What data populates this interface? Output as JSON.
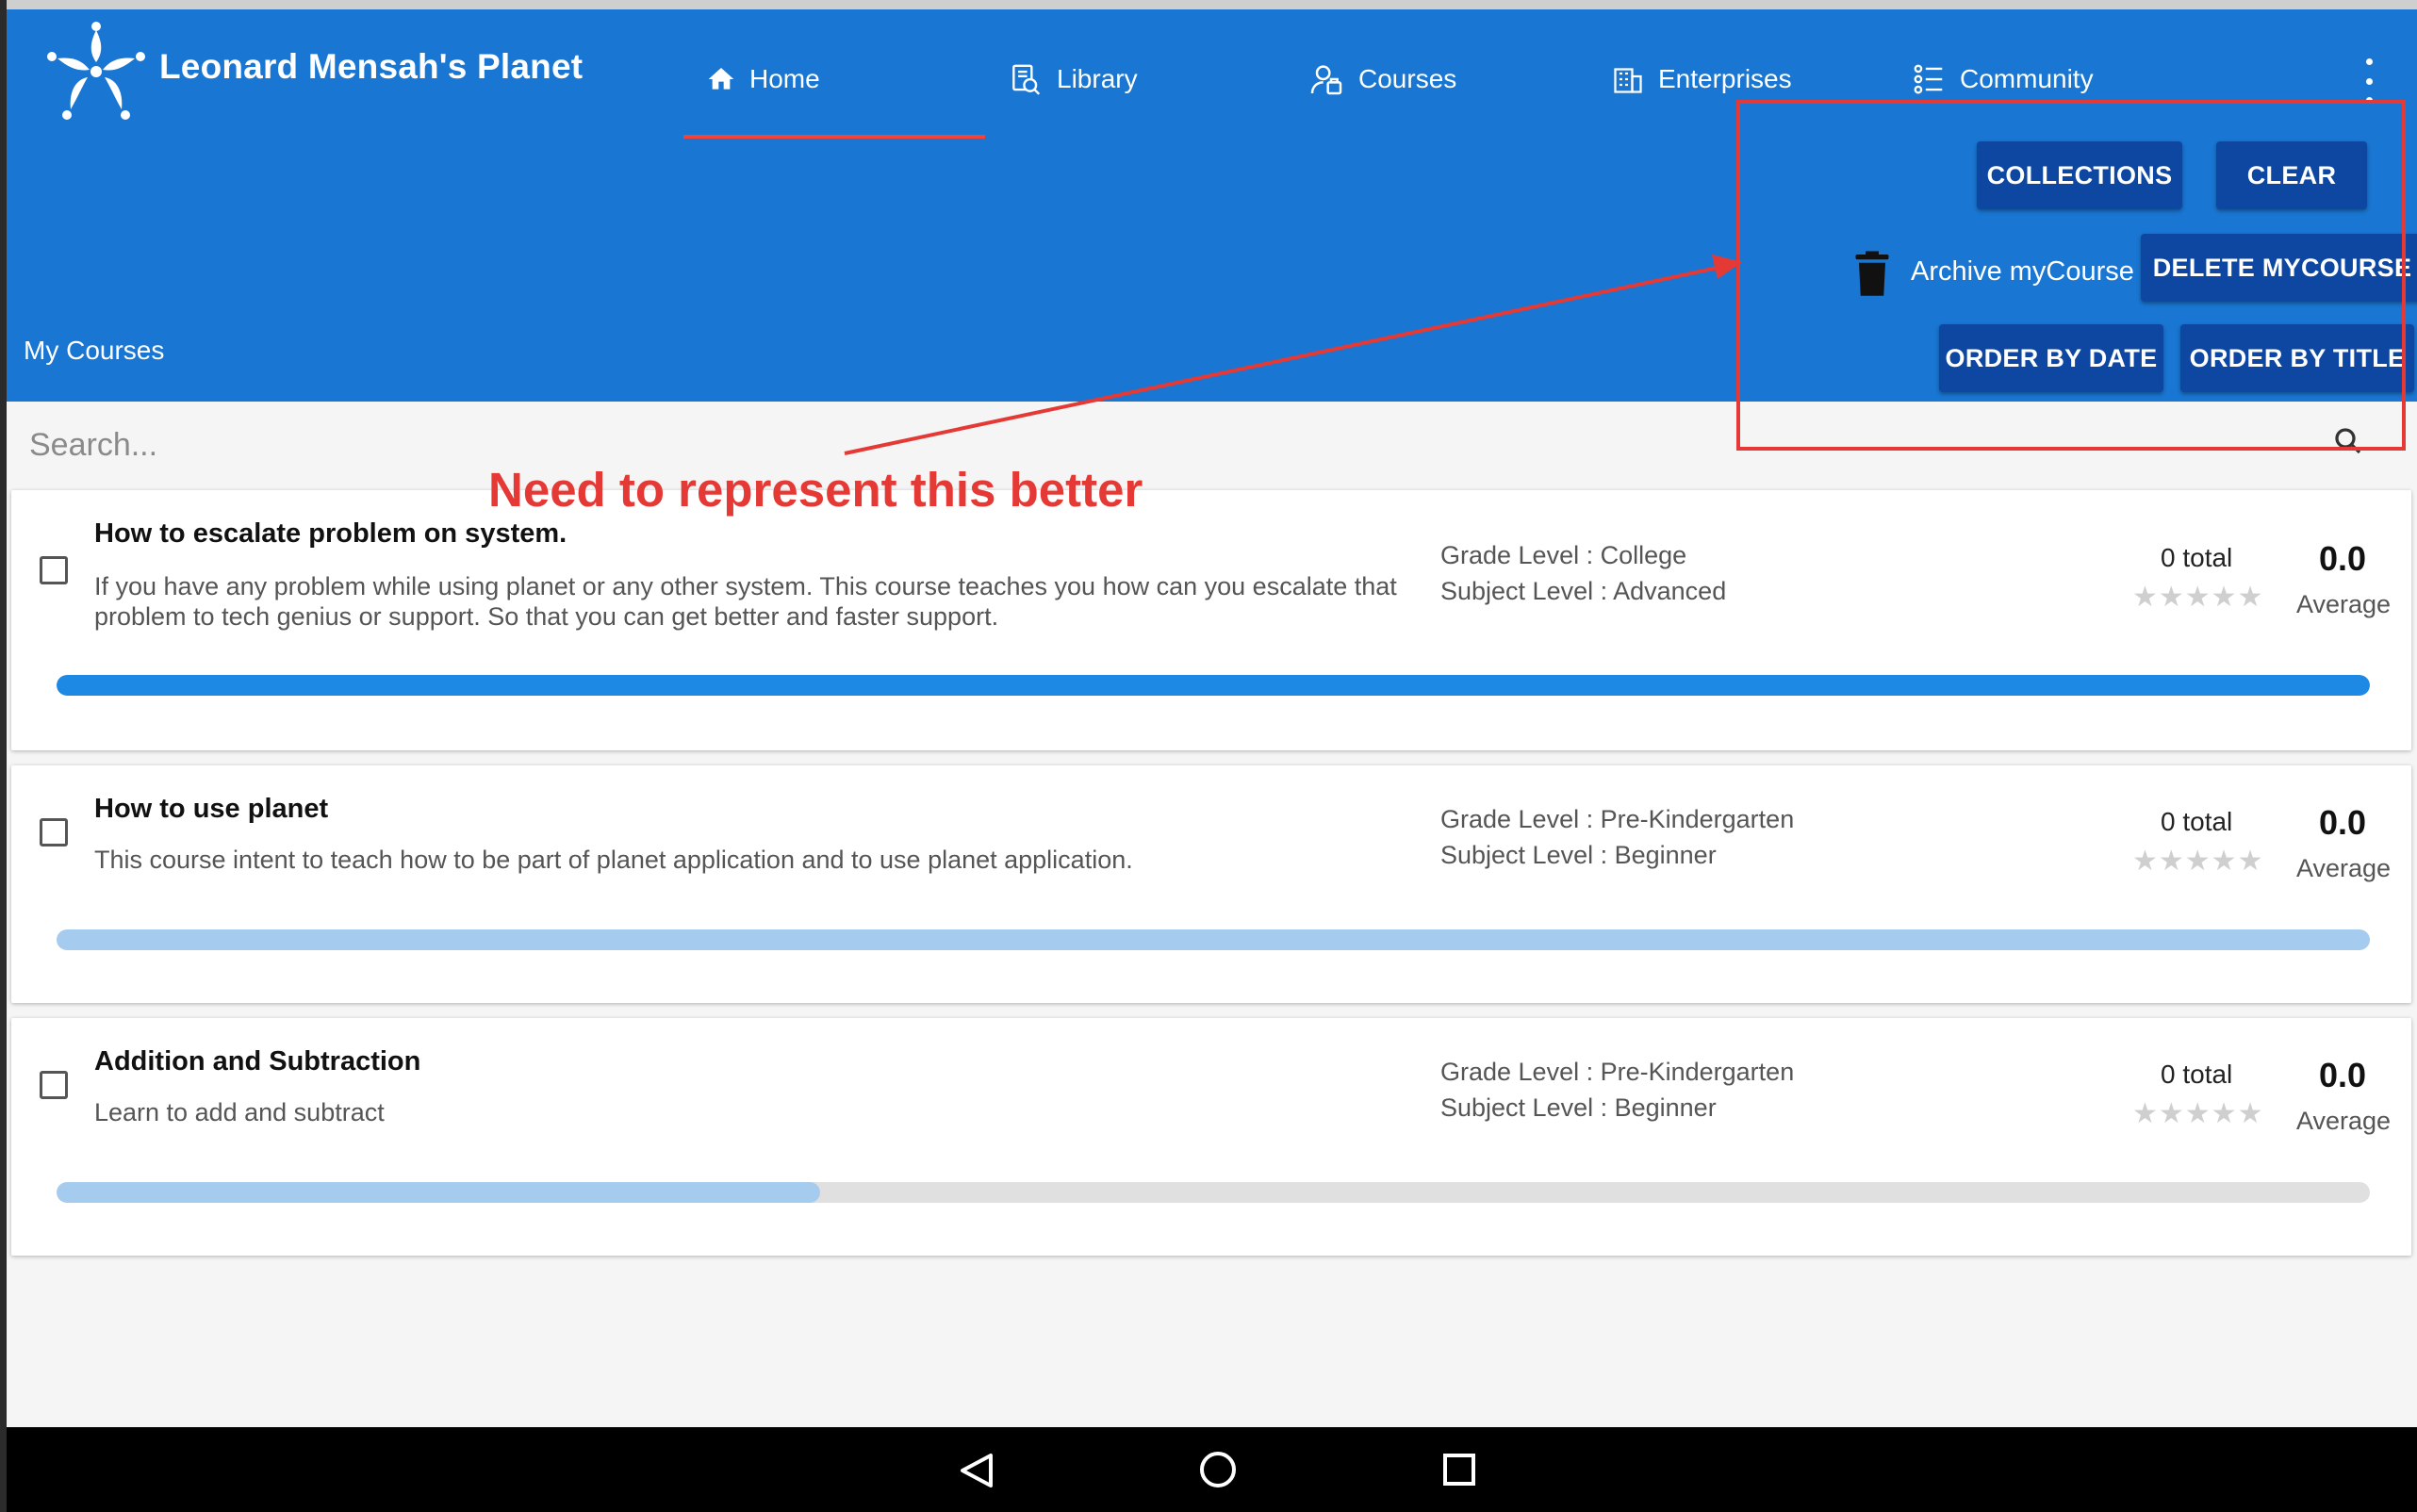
{
  "app": {
    "brand_name": "Leonard Mensah's Planet",
    "logo_icon": "planet-logo-icon",
    "primary_color": "#1976d2",
    "button_color": "#0d47a1",
    "active_tab_indicator_color": "#f44336"
  },
  "nav": {
    "items": [
      {
        "label": "Home",
        "icon": "home-icon",
        "active": true
      },
      {
        "label": "Library",
        "icon": "library-icon",
        "active": false
      },
      {
        "label": "Courses",
        "icon": "courses-icon",
        "active": false
      },
      {
        "label": "Enterprises",
        "icon": "enterprises-icon",
        "active": false
      },
      {
        "label": "Community",
        "icon": "community-icon",
        "active": false
      }
    ],
    "menu_icon": "more-vert-icon"
  },
  "page": {
    "title": "My Courses"
  },
  "toolbar": {
    "collections_label": "COLLECTIONS",
    "clear_label": "CLEAR",
    "archive_label": "Archive myCourse",
    "archive_icon": "trash-icon",
    "delete_label": "DELETE MYCOURSE",
    "order_date_label": "ORDER BY DATE",
    "order_title_label": "ORDER BY TITLE"
  },
  "search": {
    "placeholder": "Search...",
    "value": "",
    "icon": "search-icon"
  },
  "courses": [
    {
      "title": "How to escalate problem on system.",
      "description": "If you have any problem while using planet or any other system. This course teaches you how can you escalate that problem to tech genius or support. So that you can get better and faster support.",
      "grade_level": "Grade Level  : College",
      "subject_level": "Subject Level : Advanced",
      "rating_total": "0 total",
      "rating_average": "0.0",
      "average_label": "Average",
      "rating_stars": 0,
      "progress": 1.0,
      "progress_color": "#1e88e5"
    },
    {
      "title": "How to use planet",
      "description": "This course intent to teach how to be part of planet application and to use planet application.",
      "grade_level": "Grade Level  : Pre-Kindergarten",
      "subject_level": "Subject Level : Beginner",
      "rating_total": "0 total",
      "rating_average": "0.0",
      "average_label": "Average",
      "rating_stars": 0,
      "progress": 1.0,
      "progress_color": "#a5cbef"
    },
    {
      "title": "Addition and Subtraction",
      "description": "Learn to add and subtract",
      "grade_level": "Grade Level  : Pre-Kindergarten",
      "subject_level": "Subject Level : Beginner",
      "rating_total": "0 total",
      "rating_average": "0.0",
      "average_label": "Average",
      "rating_stars": 0,
      "progress": 0.33,
      "progress_color": "#a5cbef"
    }
  ],
  "annotation": {
    "text": "Need to represent this better",
    "color": "#e53935"
  },
  "system_nav": {
    "back_icon": "back-triangle-icon",
    "home_icon": "home-circle-icon",
    "recents_icon": "recents-square-icon"
  }
}
